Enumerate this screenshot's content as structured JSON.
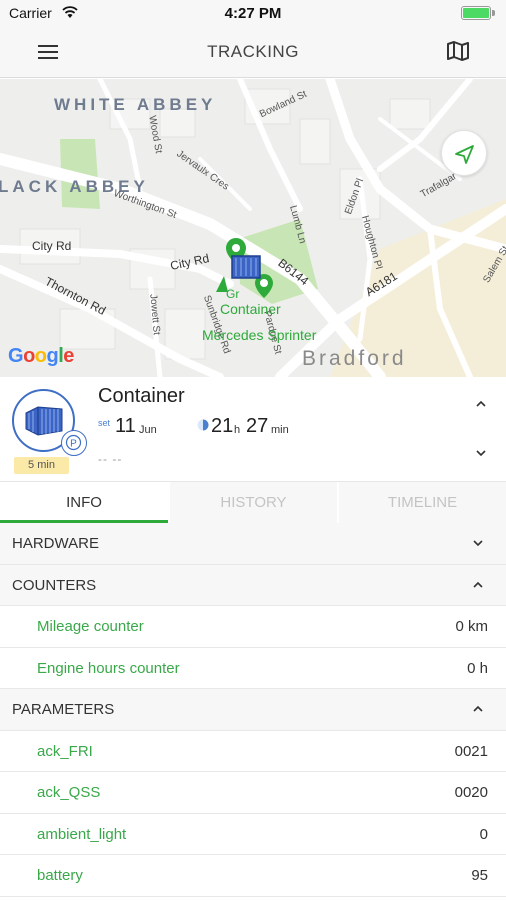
{
  "status_bar": {
    "carrier": "Carrier",
    "time": "4:27 PM"
  },
  "nav": {
    "title": "TRACKING",
    "left_icon": "hamburger-menu-icon",
    "right_icon": "map-icon"
  },
  "map": {
    "districts": [
      "WHITE ABBEY",
      "LACK ABBEY"
    ],
    "city": "Bradford",
    "roads": [
      "City Rd",
      "City Rd",
      "Thornton Rd",
      "B6144",
      "A6181"
    ],
    "streets": [
      "Wood St",
      "Jervaulx Cres",
      "Bowland St",
      "Worthington St",
      "Lumb Ln",
      "Eldon Pl",
      "Houghton Pl",
      "Trafalgar St",
      "Salem St",
      "Jowett St",
      "Sunbridge Rd",
      "Pardoe St"
    ],
    "marker_labels": [
      "Container",
      "Mercedes Sprinter"
    ],
    "marker_partial": "Gr",
    "google": [
      "G",
      "o",
      "o",
      "g",
      "l",
      "e"
    ],
    "compass_icon": "navigation-arrow-icon"
  },
  "object": {
    "name": "Container",
    "age_badge": "5 min",
    "calendar_icon_text": "set",
    "date_day": "11",
    "date_month": "Jun",
    "duration_hours": "21",
    "duration_hours_unit": "h",
    "duration_minutes": "27",
    "duration_minutes_unit": "min",
    "address": "-- --",
    "badge_letter": "P"
  },
  "tabs": [
    {
      "label": "INFO",
      "active": true
    },
    {
      "label": "HISTORY",
      "active": false
    },
    {
      "label": "TIMELINE",
      "active": false
    }
  ],
  "sections": {
    "hardware": {
      "title": "HARDWARE",
      "expanded": false
    },
    "counters": {
      "title": "COUNTERS",
      "expanded": true,
      "items": [
        {
          "label": "Mileage counter",
          "value": "0 km"
        },
        {
          "label": "Engine hours counter",
          "value": "0 h"
        }
      ]
    },
    "parameters": {
      "title": "PARAMETERS",
      "expanded": true,
      "items": [
        {
          "label": "ack_FRI",
          "value": "0021"
        },
        {
          "label": "ack_QSS",
          "value": "0020"
        },
        {
          "label": "ambient_light",
          "value": "0"
        },
        {
          "label": "battery",
          "value": "95"
        }
      ]
    }
  },
  "colors": {
    "accent_green": "#2eaa3b",
    "item_green": "#3aa84a",
    "avatar_blue": "#3f6fc4",
    "age_badge_bg": "#fbe9a8",
    "map_park": "#c8e6b5",
    "google_blue": "#4285f4",
    "google_red": "#ea4335",
    "google_yellow": "#fbbc05",
    "google_green": "#34a853"
  }
}
